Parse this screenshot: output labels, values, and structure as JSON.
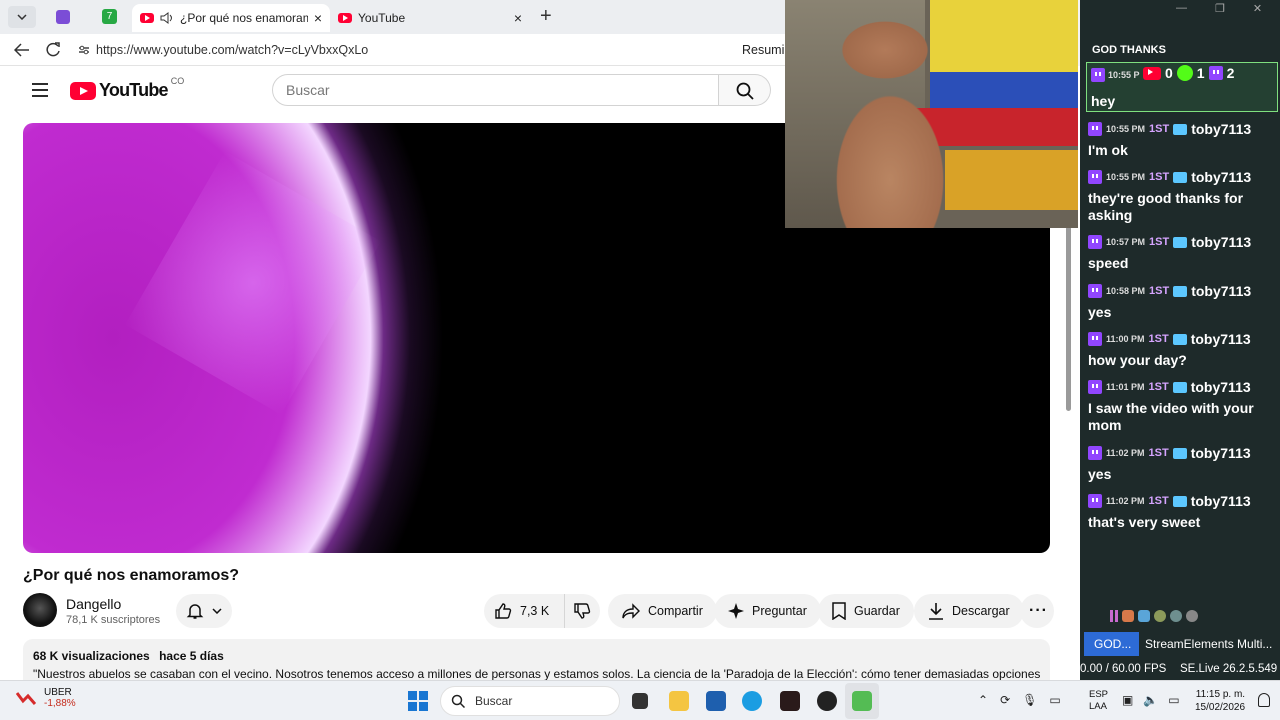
{
  "browser": {
    "tabs": [
      {
        "label": "¿Por qué nos enamoramos?",
        "active": true
      },
      {
        "label": "YouTube",
        "active": false
      }
    ],
    "url": "https://www.youtube.com/watch?v=cLyVbxxQxLo",
    "right_text": "Resumir"
  },
  "youtube": {
    "logo_text": "YouTube",
    "region": "CO",
    "search_placeholder": "Buscar",
    "video_title": "¿Por qué nos enamoramos?",
    "channel": {
      "name": "Dangello",
      "subscribers": "78,1 K suscriptores"
    },
    "actions": {
      "likes": "7,3 K",
      "share": "Compartir",
      "ask": "Preguntar",
      "save": "Guardar",
      "download": "Descargar"
    },
    "description": {
      "views": "68 K visualizaciones",
      "date": "hace 5 días",
      "text": "\"Nuestros abuelos se casaban con el vecino. Nosotros tenemos acceso a millones de personas y estamos solos. La ciencia de la 'Paradoja de la Elección': cómo tener demasiadas opciones hace"
    }
  },
  "chat": {
    "title": "GOD THANKS",
    "top_counts": {
      "youtube": "0",
      "kick": "1",
      "twitch": "2"
    },
    "first_message": {
      "time": "10:55 P",
      "text": "hey"
    },
    "messages": [
      {
        "time": "10:55 PM",
        "badge": "1ST",
        "user": "toby7113",
        "text": "I'm ok"
      },
      {
        "time": "10:55 PM",
        "badge": "1ST",
        "user": "toby7113",
        "text": "they're good thanks for asking"
      },
      {
        "time": "10:57 PM",
        "badge": "1ST",
        "user": "toby7113",
        "text": "speed"
      },
      {
        "time": "10:58 PM",
        "badge": "1ST",
        "user": "toby7113",
        "text": "yes"
      },
      {
        "time": "11:00 PM",
        "badge": "1ST",
        "user": "toby7113",
        "text": "how your day?"
      },
      {
        "time": "11:01 PM",
        "badge": "1ST",
        "user": "toby7113",
        "text": "I saw the video with your mom"
      },
      {
        "time": "11:02 PM",
        "badge": "1ST",
        "user": "toby7113",
        "text": "yes"
      },
      {
        "time": "11:02 PM",
        "badge": "1ST",
        "user": "toby7113",
        "text": "that's very sweet"
      }
    ],
    "obs_tabs": [
      "GOD...",
      "StreamElements Multi..."
    ],
    "fps": "0.00 / 60.00 FPS",
    "version": "SE.Live 26.2.5.549"
  },
  "taskbar": {
    "stock_name": "UBER",
    "stock_change": "-1,88%",
    "search": "Buscar",
    "lang": "ESP",
    "lang_sub": "LAA",
    "time": "11:15 p. m.",
    "date": "15/02/2026"
  },
  "colors": {
    "youtube_red": "#ff0033",
    "twitch_purple": "#9146ff",
    "chat_bg": "#1e2a2a"
  }
}
